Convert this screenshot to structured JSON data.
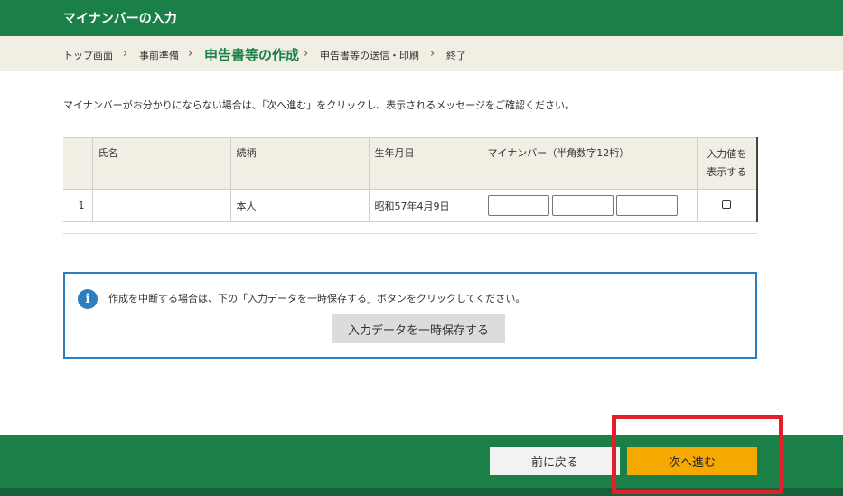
{
  "header": {
    "title": "マイナンバーの入力"
  },
  "steps": [
    {
      "label": "トップ画面"
    },
    {
      "label": "事前準備"
    },
    {
      "label": "申告書等の作成"
    },
    {
      "label": "申告書等の送信・印刷"
    },
    {
      "label": "終了"
    }
  ],
  "steps_current_index": 2,
  "breadcrumb_separator": "›",
  "instruction": "マイナンバーがお分かりにならない場合は、「次へ進む」をクリックし、表示されるメッセージをご確認ください。",
  "table": {
    "headers": {
      "name": "氏名",
      "relation": "続柄",
      "birthdate": "生年月日",
      "mynumber": "マイナンバー（半角数字12桁）",
      "show_line1": "入力値を",
      "show_line2": "表示する"
    },
    "rows": [
      {
        "num": "1",
        "name": "",
        "relation": "本人",
        "birthdate": "昭和57年4月9日",
        "mynumber_parts": [
          "",
          "",
          ""
        ],
        "show_checked": false
      }
    ]
  },
  "info": {
    "icon": "info-icon",
    "text": "作成を中断する場合は、下の「入力データを一時保存する」ボタンをクリックしてください。",
    "save_button": "入力データを一時保存する"
  },
  "footer": {
    "back_button": "前に戻る",
    "next_button": "次へ進む"
  },
  "colors": {
    "header_green": "#1a8048",
    "steps_bg": "#f1efe4",
    "next_button": "#f5a800",
    "info_border": "#2b7fc0",
    "highlight_red": "#e0202a"
  }
}
